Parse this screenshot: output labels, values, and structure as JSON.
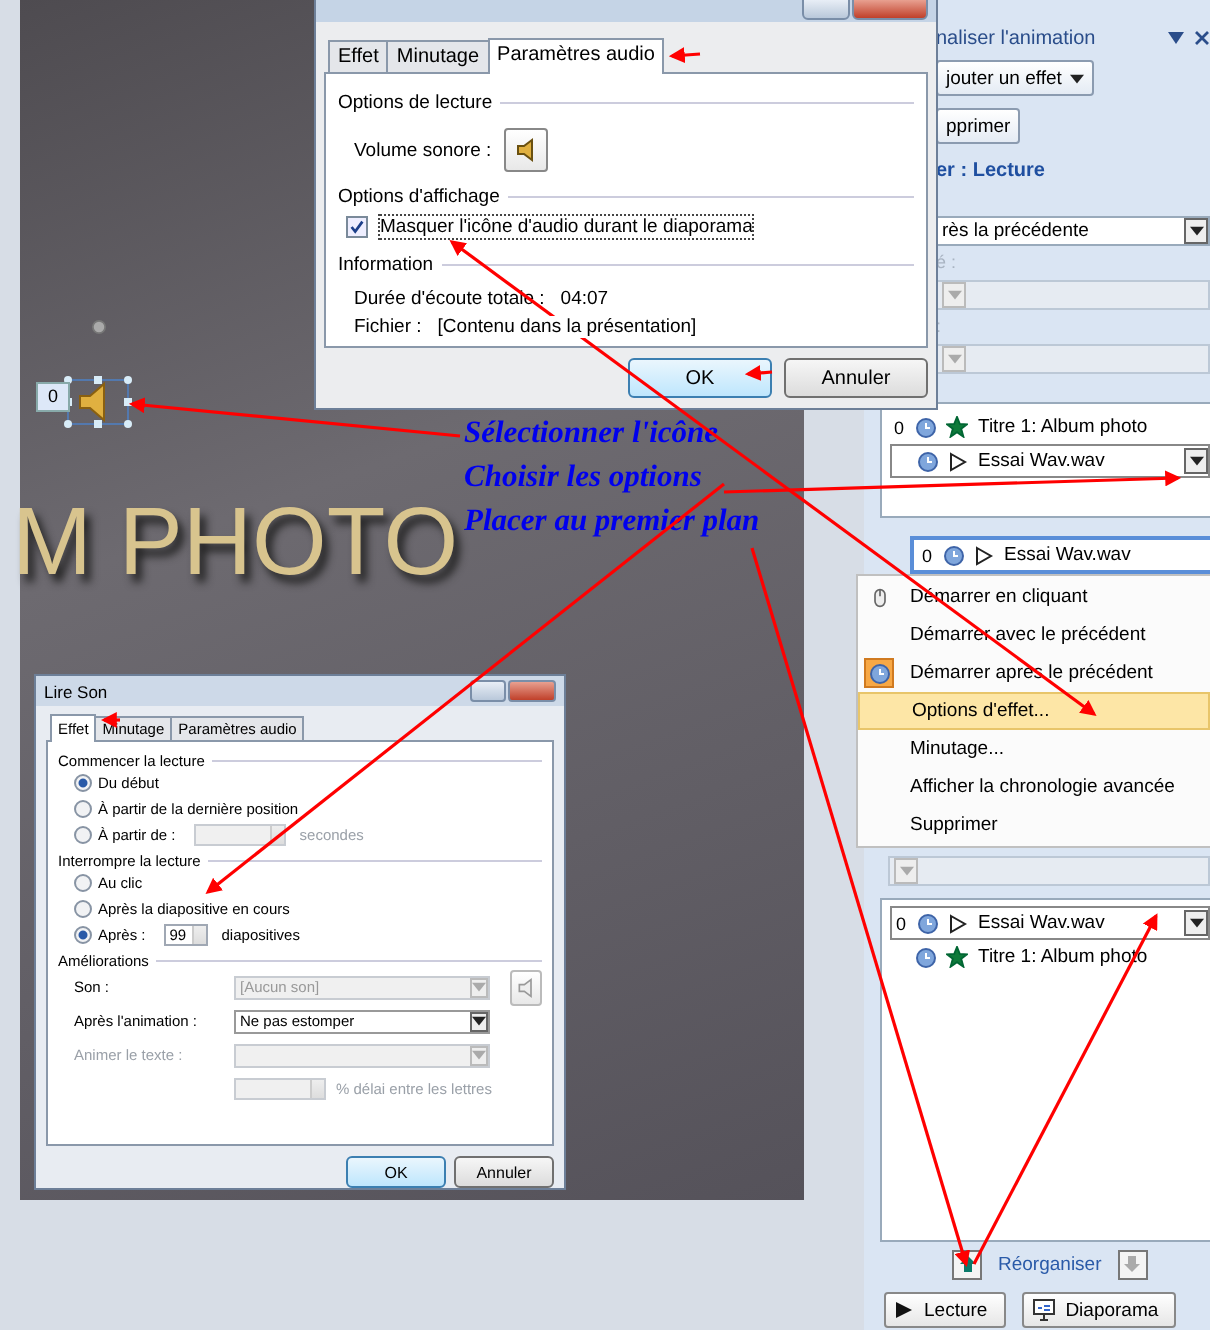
{
  "slide": {
    "title": "M PHOTO",
    "sound_badge": "0"
  },
  "annotations": [
    "Sélectionner l'icône",
    "Choisir les options",
    "Placer au premier plan"
  ],
  "audio_dialog": {
    "tabs": [
      {
        "label": "Effet",
        "selected": false
      },
      {
        "label": "Minutage",
        "selected": false
      },
      {
        "label": "Paramètres audio",
        "selected": true
      }
    ],
    "playback_heading": "Options de lecture",
    "volume_label": "Volume sonore :",
    "display_heading": "Options d'affichage",
    "hide_icon": {
      "label": "Masquer l'icône d'audio durant le diaporama",
      "checked": true
    },
    "info_heading": "Information",
    "info": [
      {
        "label": "Durée d'écoute totale :",
        "value": "04:07"
      },
      {
        "label": "Fichier :",
        "value": "[Contenu dans la présentation]"
      }
    ],
    "buttons": [
      "OK",
      "Annuler"
    ]
  },
  "lire_son_dialog": {
    "title": "Lire Son",
    "tabs": [
      {
        "label": "Effet",
        "selected": true
      },
      {
        "label": "Minutage",
        "selected": false
      },
      {
        "label": "Paramètres audio",
        "selected": false
      }
    ],
    "start_heading": "Commencer la lecture",
    "start_options": [
      {
        "label": "Du début",
        "selected": true,
        "kind": "plain"
      },
      {
        "label": "À partir de la dernière position",
        "selected": false,
        "kind": "plain"
      },
      {
        "label": "À partir de :",
        "selected": false,
        "kind": "spin",
        "unit": "secondes"
      }
    ],
    "stop_heading": "Interrompre la lecture",
    "stop_options": [
      {
        "label": "Au clic",
        "selected": false,
        "kind": "plain"
      },
      {
        "label": "Après la diapositive en cours",
        "selected": false,
        "kind": "plain"
      },
      {
        "label": "Après :",
        "selected": true,
        "kind": "spin",
        "value": "99",
        "unit": "diapositives"
      }
    ],
    "enhance_heading": "Améliorations",
    "fields": [
      {
        "label": "Son :",
        "value": "[Aucun son]",
        "disabled": true,
        "kind": "sound"
      },
      {
        "label": "Après l'animation :",
        "value": "Ne pas estomper",
        "disabled": false,
        "kind": "plain"
      },
      {
        "label": "Animer le texte :",
        "disabled": true,
        "kind": "plain"
      }
    ],
    "delay_label": "% délai entre les lettres",
    "buttons": [
      "OK",
      "Annuler"
    ]
  },
  "animation_pane": {
    "title": "naliser l'animation",
    "add_effect": "jouter un effet",
    "remove": "pprimer",
    "selection_heading": "er : Lecture",
    "start": "rès la précédente",
    "property_label": "é :",
    "speed_label": ":",
    "list": [
      {
        "number": "0",
        "kind": "entrance",
        "name": "Titre 1: Album photo",
        "selected": false
      },
      {
        "kind": "media",
        "name": "Essai Wav.wav",
        "selected": true
      }
    ],
    "menu_header": {
      "number": "0",
      "name": "Essai Wav.wav"
    },
    "menu": [
      {
        "label": "Démarrer en cliquant",
        "kind": "mouse",
        "checked": false,
        "selected": false
      },
      {
        "label": "Démarrer avec le précédent",
        "kind": "plain",
        "checked": false,
        "selected": false
      },
      {
        "label": "Démarrer après le précédent",
        "kind": "clock",
        "checked": true,
        "selected": false
      },
      {
        "label": "Options d'effet...",
        "kind": "plain",
        "checked": false,
        "selected": true
      },
      {
        "label": "Minutage...",
        "kind": "plain",
        "checked": false,
        "selected": false
      },
      {
        "label": "Afficher la chronologie avancée",
        "kind": "plain",
        "checked": false,
        "selected": false
      },
      {
        "label": "Supprimer",
        "kind": "plain",
        "checked": false,
        "selected": false
      }
    ],
    "list_after": [
      {
        "number": "0",
        "kind": "media",
        "name": "Essai Wav.wav",
        "selected": true
      },
      {
        "kind": "entrance",
        "name": "Titre 1: Album photo",
        "selected": false
      }
    ],
    "reorder": "Réorganiser",
    "buttons": [
      {
        "kind": "play",
        "label": "Lecture"
      },
      {
        "kind": "slideshow",
        "label": "Diaporama"
      }
    ]
  }
}
